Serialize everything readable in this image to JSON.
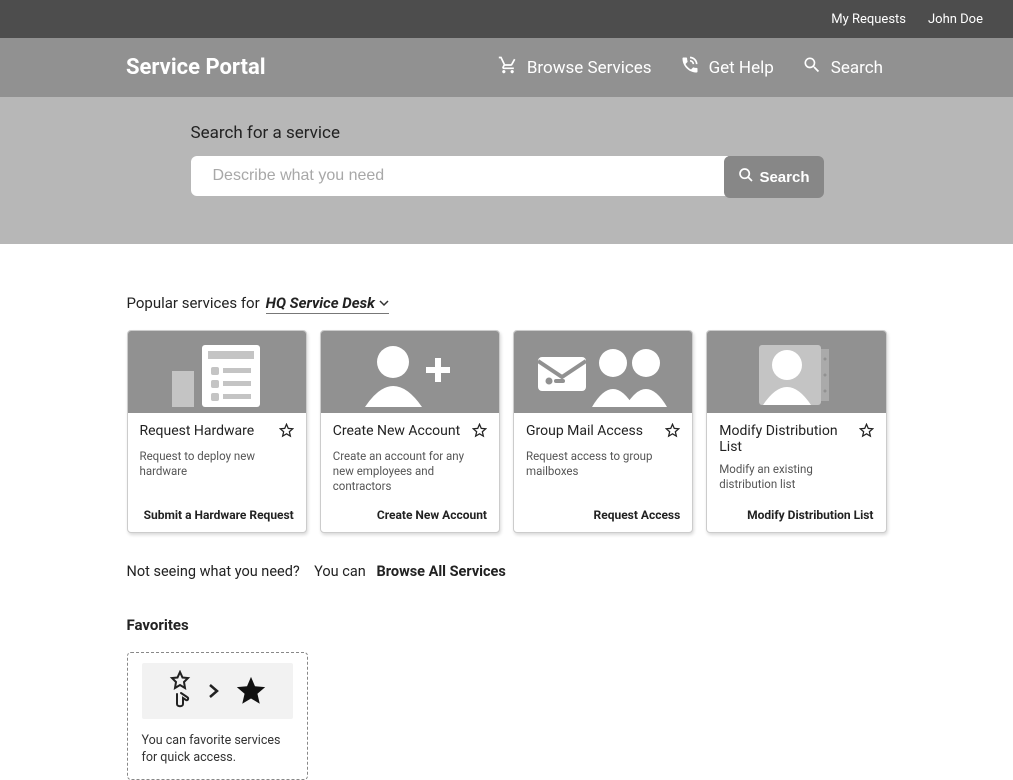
{
  "topbar": {
    "my_requests": "My Requests",
    "user_name": "John Doe"
  },
  "navbar": {
    "title": "Service Portal",
    "browse": "Browse Services",
    "help": "Get Help",
    "search": "Search"
  },
  "hero": {
    "label": "Search for a service",
    "placeholder": "Describe what you need",
    "button": "Search"
  },
  "popular": {
    "prefix": "Popular services for",
    "department": "HQ Service Desk"
  },
  "cards": [
    {
      "title": "Request Hardware",
      "desc": "Request to deploy new hardware",
      "action": "Submit a Hardware Request"
    },
    {
      "title": "Create New Account",
      "desc": "Create an account for any new employees and contractors",
      "action": "Create New Account"
    },
    {
      "title": "Group Mail Access",
      "desc": "Request access to group mailboxes",
      "action": "Request Access"
    },
    {
      "title": "Modify Distribution List",
      "desc": "Modify an existing distribution list",
      "action": "Modify Distribution List"
    }
  ],
  "not_seeing": {
    "q": "Not seeing what you need?",
    "you_can": "You can",
    "browse_all": "Browse All Services"
  },
  "favorites": {
    "title": "Favorites",
    "hint": "You can favorite services for quick access."
  }
}
